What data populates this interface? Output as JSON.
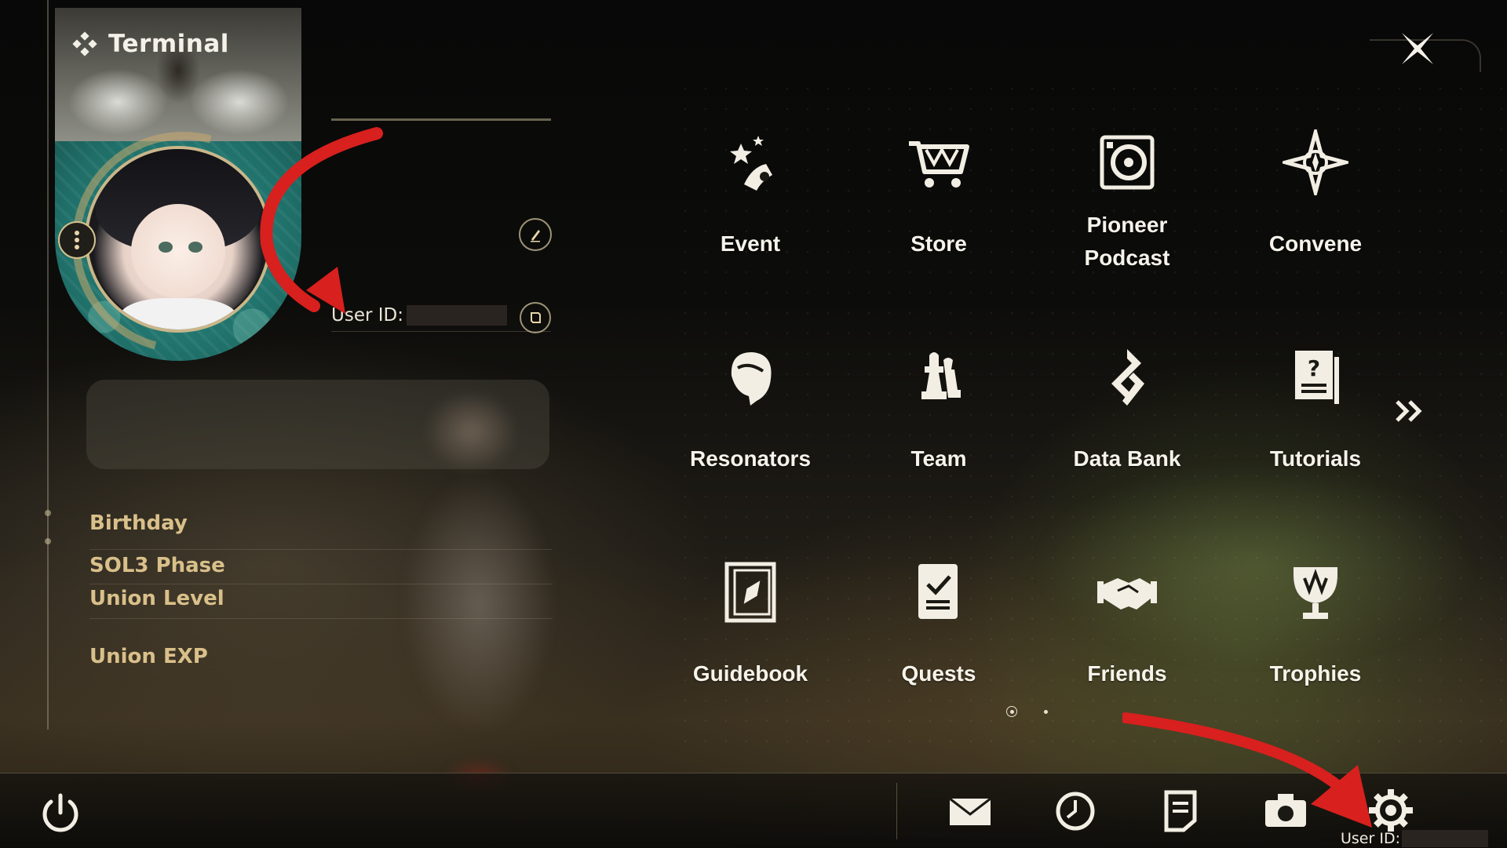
{
  "panel": {
    "title": "Terminal",
    "uid_label": "User ID:",
    "stats": [
      "Birthday",
      "SOL3 Phase",
      "Union Level",
      "Union EXP"
    ]
  },
  "functions": [
    {
      "label": "Event",
      "icon": "event-icon"
    },
    {
      "label": "Store",
      "icon": "store-cart-icon"
    },
    {
      "label": "Pioneer\nPodcast",
      "icon": "podcast-icon"
    },
    {
      "label": "Convene",
      "icon": "convene-icon"
    },
    {
      "label": "Resonators",
      "icon": "resonators-icon"
    },
    {
      "label": "Team",
      "icon": "team-icon"
    },
    {
      "label": "Data Bank",
      "icon": "data-bank-icon"
    },
    {
      "label": "Tutorials",
      "icon": "tutorials-icon"
    },
    {
      "label": "Guidebook",
      "icon": "guidebook-icon"
    },
    {
      "label": "Quests",
      "icon": "quests-icon"
    },
    {
      "label": "Friends",
      "icon": "friends-icon"
    },
    {
      "label": "Trophies",
      "icon": "trophies-icon"
    }
  ],
  "pagination": {
    "current_page": 1,
    "total_pages": 2
  },
  "bottom_bar": {
    "icons": [
      "power-icon",
      "mail-icon",
      "clock-icon",
      "notes-icon",
      "camera-icon",
      "settings-gear-icon"
    ],
    "uid_label": "User ID:"
  },
  "colors": {
    "accent_gold": "#d9c08a",
    "annotation_red": "#d8201e",
    "text": "#f6f3ea"
  }
}
